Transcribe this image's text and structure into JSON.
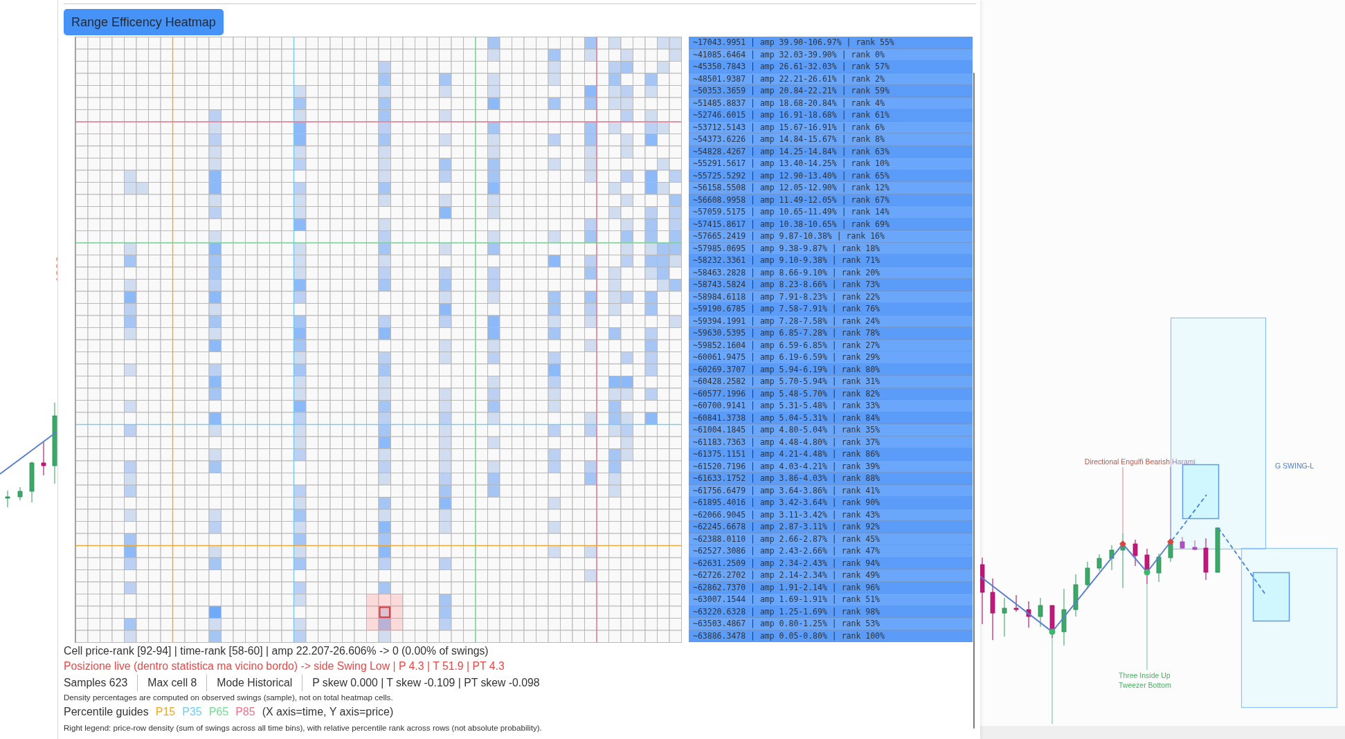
{
  "title_button": {
    "label": "Range Efficency Heatmap"
  },
  "heatmap": {
    "legend": [
      {
        "text": "~17043.9951 | amp 39.90-106.97% | rank 55%",
        "color": "#5a9cf8"
      },
      {
        "text": "~41085.6464 | amp 32.03-39.90% | rank 0%",
        "color": "#6aa7fb"
      },
      {
        "text": "~45350.7843 | amp 26.61-32.03% | rank 57%",
        "color": "#5a9cf8"
      },
      {
        "text": "~48501.9387 | amp 22.21-26.61% | rank 2%",
        "color": "#6aa7fb"
      },
      {
        "text": "~50353.3659 | amp 20.84-22.21% | rank 59%",
        "color": "#5a9cf8"
      },
      {
        "text": "~51485.8837 | amp 18.68-20.84% | rank 4%",
        "color": "#6aa7fb"
      },
      {
        "text": "~52746.6015 | amp 16.91-18.68% | rank 61%",
        "color": "#5a9cf8"
      },
      {
        "text": "~53712.5143 | amp 15.67-16.91% | rank 6%",
        "color": "#6aa7fb"
      },
      {
        "text": "~54373.6226 | amp 14.84-15.67% | rank 8%",
        "color": "#6aa7fb"
      },
      {
        "text": "~54828.4267 | amp 14.25-14.84% | rank 63%",
        "color": "#5a9cf8"
      },
      {
        "text": "~55291.5617 | amp 13.40-14.25% | rank 10%",
        "color": "#6aa7fb"
      },
      {
        "text": "~55725.5292 | amp 12.90-13.40% | rank 65%",
        "color": "#5a9cf8"
      },
      {
        "text": "~56158.5508 | amp 12.05-12.90% | rank 12%",
        "color": "#6aa7fb"
      },
      {
        "text": "~56608.9958 | amp 11.49-12.05% | rank 67%",
        "color": "#5a9cf8"
      },
      {
        "text": "~57059.5175 | amp 10.65-11.49% | rank 14%",
        "color": "#6aa7fb"
      },
      {
        "text": "~57415.8617 | amp 10.38-10.65% | rank 69%",
        "color": "#5a9cf8"
      },
      {
        "text": "~57665.2419 | amp 9.87-10.38% | rank 16%",
        "color": "#6aa7fb"
      },
      {
        "text": "~57985.0695 | amp 9.38-9.87% | rank 18%",
        "color": "#6aa7fb"
      },
      {
        "text": "~58232.3361 | amp 9.10-9.38% | rank 71%",
        "color": "#5a9cf8"
      },
      {
        "text": "~58463.2828 | amp 8.66-9.10% | rank 20%",
        "color": "#6aa7fb"
      },
      {
        "text": "~58743.5824 | amp 8.23-8.66% | rank 73%",
        "color": "#5a9cf8"
      },
      {
        "text": "~58984.6118 | amp 7.91-8.23% | rank 22%",
        "color": "#6aa7fb"
      },
      {
        "text": "~59190.6785 | amp 7.58-7.91% | rank 76%",
        "color": "#5a9cf8"
      },
      {
        "text": "~59394.1991 | amp 7.28-7.58% | rank 24%",
        "color": "#6aa7fb"
      },
      {
        "text": "~59630.5395 | amp 6.85-7.28% | rank 78%",
        "color": "#5a9cf8"
      },
      {
        "text": "~59852.1604 | amp 6.59-6.85% | rank 27%",
        "color": "#6aa7fb"
      },
      {
        "text": "~60061.9475 | amp 6.19-6.59% | rank 29%",
        "color": "#6aa7fb"
      },
      {
        "text": "~60269.3707 | amp 5.94-6.19% | rank 80%",
        "color": "#5a9cf8"
      },
      {
        "text": "~60428.2582 | amp 5.70-5.94% | rank 31%",
        "color": "#6aa7fb"
      },
      {
        "text": "~60577.1996 | amp 5.48-5.70% | rank 82%",
        "color": "#5a9cf8"
      },
      {
        "text": "~60700.9141 | amp 5.31-5.48% | rank 33%",
        "color": "#6aa7fb"
      },
      {
        "text": "~60841.3738 | amp 5.04-5.31% | rank 84%",
        "color": "#5a9cf8"
      },
      {
        "text": "~61004.1845 | amp 4.80-5.04% | rank 35%",
        "color": "#6aa7fb"
      },
      {
        "text": "~61183.7363 | amp 4.48-4.80% | rank 37%",
        "color": "#6aa7fb"
      },
      {
        "text": "~61375.1151 | amp 4.21-4.48% | rank 86%",
        "color": "#5a9cf8"
      },
      {
        "text": "~61520.7196 | amp 4.03-4.21% | rank 39%",
        "color": "#6aa7fb"
      },
      {
        "text": "~61633.1752 | amp 3.86-4.03% | rank 88%",
        "color": "#5a9cf8"
      },
      {
        "text": "~61756.6479 | amp 3.64-3.86% | rank 41%",
        "color": "#6aa7fb"
      },
      {
        "text": "~61895.4016 | amp 3.42-3.64% | rank 90%",
        "color": "#5a9cf8"
      },
      {
        "text": "~62066.9045 | amp 3.11-3.42% | rank 43%",
        "color": "#6aa7fb"
      },
      {
        "text": "~62245.6678 | amp 2.87-3.11% | rank 92%",
        "color": "#5a9cf8"
      },
      {
        "text": "~62388.0110 | amp 2.66-2.87% | rank 45%",
        "color": "#6aa7fb"
      },
      {
        "text": "~62527.3086 | amp 2.43-2.66% | rank 47%",
        "color": "#6aa7fb"
      },
      {
        "text": "~62631.2509 | amp 2.34-2.43% | rank 94%",
        "color": "#5a9cf8"
      },
      {
        "text": "~62726.2702 | amp 2.14-2.34% | rank 49%",
        "color": "#6aa7fb"
      },
      {
        "text": "~62862.7370 | amp 1.91-2.14% | rank 96%",
        "color": "#5a9cf8"
      },
      {
        "text": "~63007.1544 | amp 1.69-1.91% | rank 51%",
        "color": "#6aa7fb"
      },
      {
        "text": "~63220.6328 | amp 1.25-1.69% | rank 98%",
        "color": "#5a9cf8"
      },
      {
        "text": "~63503.4867 | amp 0.80-1.25% | rank 53%",
        "color": "#6aa7fb"
      },
      {
        "text": "~63886.3478 | amp 0.05-0.80% | rank 100%",
        "color": "#5a9cf8"
      }
    ]
  },
  "cell_info": "Cell price-rank [92-94] | time-rank [58-60] | amp 22.207-26.606% -> 0 (0.00% of swings)",
  "live_position": "Posizione live (dentro statistica ma vicino bordo) -> side Swing Low | P 4.3 | T 51.9 | PT 4.3",
  "stats": [
    "Samples 623",
    "Max cell 8",
    "Mode Historical",
    "P skew 0.000 | T skew -0.109 | PT skew -0.098"
  ],
  "density_note": "Density percentages are computed on observed swings (sample), not on total heatmap cells.",
  "percentile_guides": {
    "label": "Percentile guides",
    "guides": [
      {
        "label": "P15",
        "color": "#f5a623"
      },
      {
        "label": "P35",
        "color": "#6fcdf7"
      },
      {
        "label": "P65",
        "color": "#6ddf93"
      },
      {
        "label": "P85",
        "color": "#f2728c"
      }
    ],
    "axis_note": "(X axis=time, Y axis=price)"
  },
  "legend_note": "Right legend: price-row density (sum of swings across all time bins), with relative percentile rank across rows (not absolute probability).",
  "price_chart": {
    "annotations": [
      {
        "text": "Directional Engulfi Bearish",
        "color": "#c0564c"
      },
      {
        "text": "Harami",
        "color": "#a77fbf"
      },
      {
        "text": "G SWING-L",
        "color": "#4a7bd6"
      },
      {
        "text": "Three Inside Up",
        "color": "#4caf64"
      },
      {
        "text": "Tweezer Bottom",
        "color": "#4caf64"
      }
    ]
  }
}
